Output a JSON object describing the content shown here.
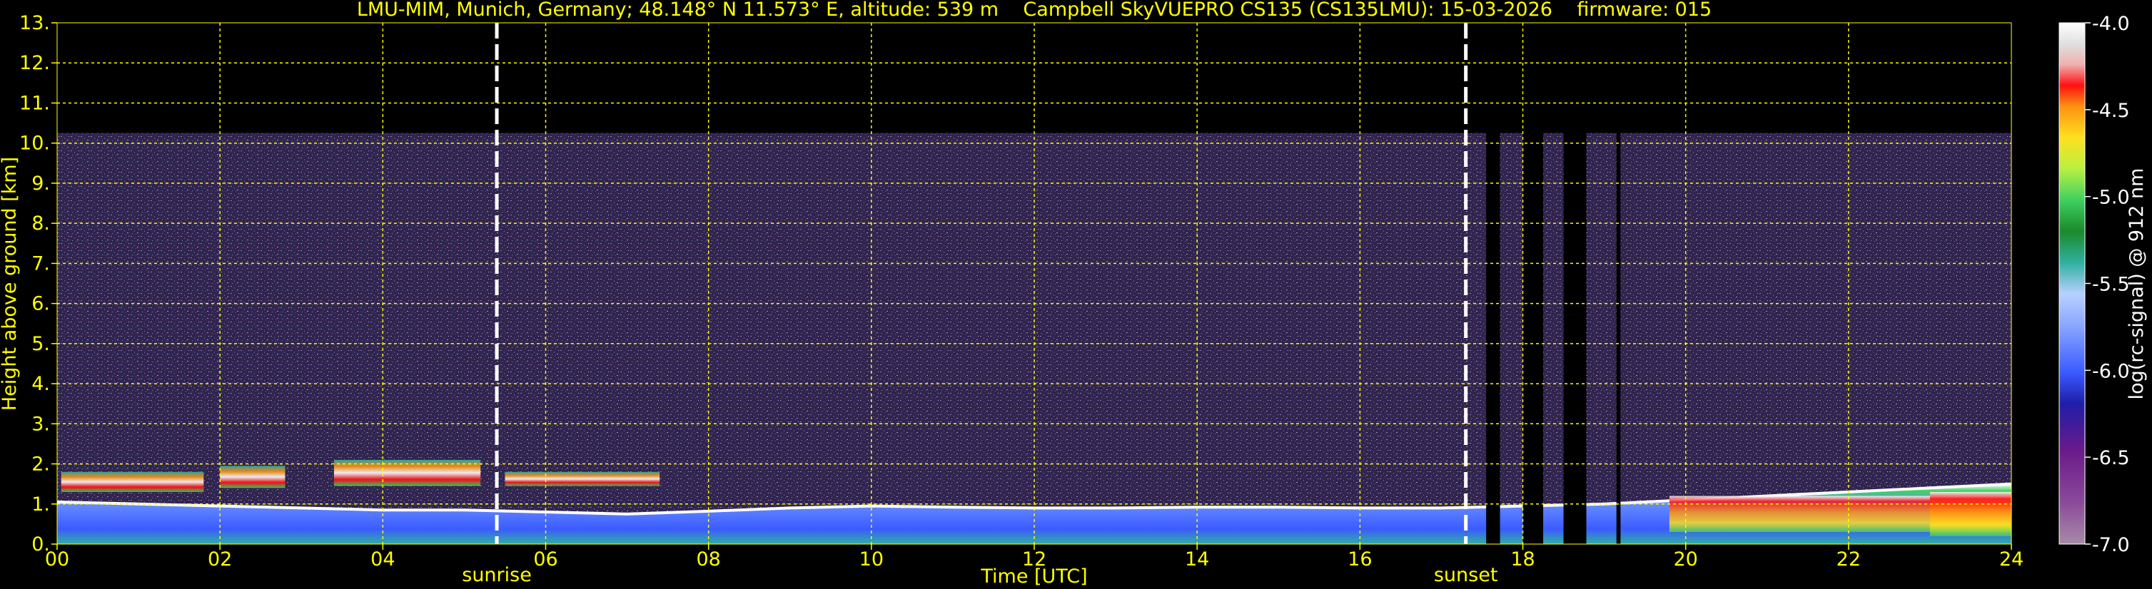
{
  "chart_data": {
    "type": "heatmap",
    "title": "LMU-MIM, Munich, Germany; 48.148° N 11.573° E, altitude: 539 m    Campbell SkyVUEPRO CS135 (CS135LMU): 15-03-2026    firmware: 015",
    "xlabel": "Time [UTC]",
    "ylabel": "Height above ground [km]",
    "xlim": [
      0,
      24
    ],
    "ylim": [
      0,
      13
    ],
    "x_ticks": [
      "00",
      "02",
      "04",
      "06",
      "08",
      "10",
      "12",
      "14",
      "16",
      "18",
      "20",
      "22",
      "24"
    ],
    "y_ticks": [
      "0.",
      "1.",
      "2.",
      "3.",
      "4.",
      "5.",
      "6.",
      "7.",
      "8.",
      "9.",
      "10.",
      "11.",
      "12.",
      "13."
    ],
    "grid": true,
    "colorbar": {
      "label": "log(rc-signal) @ 912 nm",
      "range": [
        -7.0,
        -4.0
      ],
      "ticks": [
        "-4.0",
        "-4.5",
        "-5.0",
        "-5.5",
        "-6.0",
        "-6.5",
        "-7.0"
      ]
    },
    "markers": [
      {
        "label": "sunrise",
        "time": 5.4
      },
      {
        "label": "sunset",
        "time": 17.3
      }
    ],
    "signal_top_km": 10.25,
    "data_gaps_utc": [
      [
        17.55,
        17.72
      ],
      [
        18.0,
        18.25
      ],
      [
        18.5,
        18.78
      ],
      [
        19.15,
        19.2
      ]
    ],
    "boundary_layer_top_km": [
      [
        0,
        1.05
      ],
      [
        1,
        1.0
      ],
      [
        2,
        0.95
      ],
      [
        3,
        0.9
      ],
      [
        4,
        0.85
      ],
      [
        5,
        0.85
      ],
      [
        6,
        0.8
      ],
      [
        7,
        0.75
      ],
      [
        8,
        0.82
      ],
      [
        9,
        0.9
      ],
      [
        10,
        0.95
      ],
      [
        11,
        0.92
      ],
      [
        12,
        0.9
      ],
      [
        13,
        0.9
      ],
      [
        14,
        0.92
      ],
      [
        15,
        0.92
      ],
      [
        16,
        0.9
      ],
      [
        17,
        0.9
      ],
      [
        18,
        0.95
      ],
      [
        19,
        1.0
      ],
      [
        20,
        1.1
      ],
      [
        21,
        1.2
      ],
      [
        22,
        1.3
      ],
      [
        23,
        1.4
      ],
      [
        24,
        1.5
      ]
    ],
    "cloud_layers": [
      {
        "t0": 0.05,
        "t1": 1.8,
        "base_km": 1.3,
        "top_km": 1.8
      },
      {
        "t0": 2.0,
        "t1": 2.8,
        "base_km": 1.4,
        "top_km": 1.95
      },
      {
        "t0": 3.4,
        "t1": 5.2,
        "base_km": 1.45,
        "top_km": 2.1
      },
      {
        "t0": 5.5,
        "t1": 7.4,
        "base_km": 1.45,
        "top_km": 1.8
      }
    ],
    "aerosol_layers": [
      {
        "t0": 19.8,
        "t1": 24.0,
        "base_km": 0.3,
        "top_km": 1.2
      },
      {
        "t0": 23.0,
        "t1": 24.0,
        "base_km": 0.2,
        "top_km": 1.3
      }
    ],
    "colors": {
      "background": "#000000",
      "text": "#ffff00",
      "grid": "#ffff00",
      "marker": "#ffffff",
      "noise": "#8a6cc4"
    }
  }
}
